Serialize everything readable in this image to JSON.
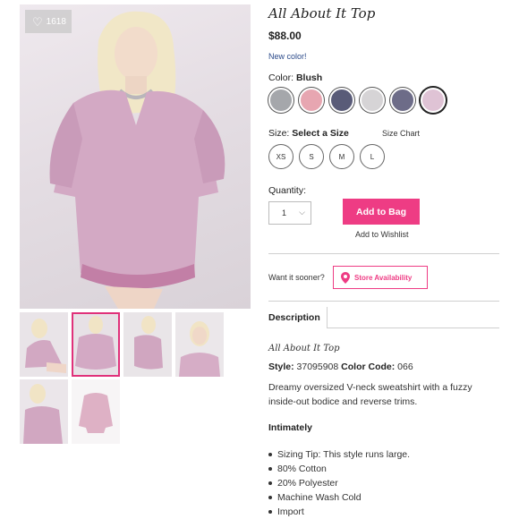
{
  "product": {
    "likes": "1618",
    "title": "All About It Top",
    "price": "$88.00",
    "new_color": "New color!",
    "color_label": "Color:",
    "color_value": "Blush",
    "size_label": "Size:",
    "size_value": "Select a Size",
    "size_chart": "Size Chart",
    "quantity_label": "Quantity:",
    "quantity_value": "1",
    "add_to_bag": "Add to Bag",
    "add_to_wishlist": "Add to Wishlist",
    "want_sooner": "Want it sooner?",
    "store_availability": "Store Availability"
  },
  "swatches": [
    {
      "name": "grey",
      "color": "#a5a7ab",
      "selected": false
    },
    {
      "name": "pink",
      "color": "#e7a6b1",
      "selected": false
    },
    {
      "name": "navy",
      "color": "#595b78",
      "selected": false
    },
    {
      "name": "light-grey",
      "color": "#d6d4d6",
      "selected": false
    },
    {
      "name": "slate",
      "color": "#6d6c88",
      "selected": false
    },
    {
      "name": "blush",
      "color": "#dfc3d5",
      "selected": true
    }
  ],
  "sizes": [
    "XS",
    "S",
    "M",
    "L"
  ],
  "description": {
    "tab": "Description",
    "title": "All About It Top",
    "style_label": "Style:",
    "style_value": "37095908",
    "color_code_label": "Color Code:",
    "color_code_value": "066",
    "text": "Dreamy oversized V-neck sweatshirt with a fuzzy inside-out bodice and reverse trims.",
    "section": "Intimately",
    "bullets": [
      "Sizing Tip: This style runs large.",
      "80% Cotton",
      "20% Polyester",
      "Machine Wash Cold",
      "Import"
    ]
  },
  "colors": {
    "accent": "#ee3c84",
    "link": "#2b4a8a"
  }
}
